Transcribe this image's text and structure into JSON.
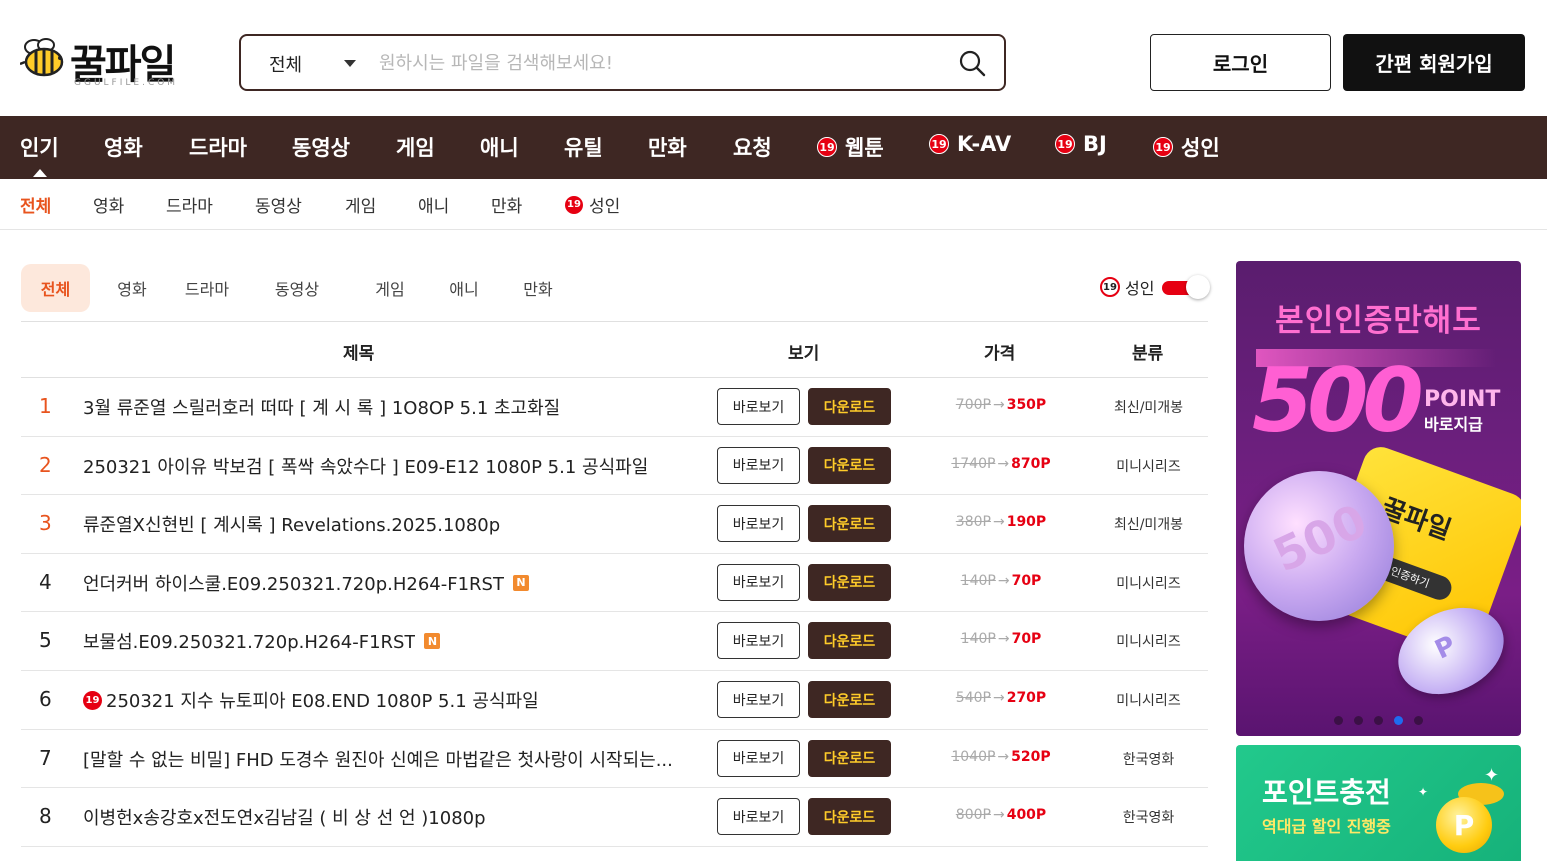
{
  "header": {
    "logo_text": "꿀파일",
    "logo_sub": "GGULFILE.COM",
    "search_category": "전체",
    "search_placeholder": "원하시는 파일을 검색해보세요!",
    "login_label": "로그인",
    "join_label": "간편 회원가입"
  },
  "main_nav": [
    {
      "label": "인기",
      "adult": false,
      "active": true
    },
    {
      "label": "영화",
      "adult": false
    },
    {
      "label": "드라마",
      "adult": false
    },
    {
      "label": "동영상",
      "adult": false
    },
    {
      "label": "게임",
      "adult": false
    },
    {
      "label": "애니",
      "adult": false
    },
    {
      "label": "유틸",
      "adult": false
    },
    {
      "label": "만화",
      "adult": false
    },
    {
      "label": "요청",
      "adult": false
    },
    {
      "label": "웹툰",
      "adult": true
    },
    {
      "label": "K-AV",
      "adult": true
    },
    {
      "label": "BJ",
      "adult": true
    },
    {
      "label": "성인",
      "adult": true
    }
  ],
  "adult_badge": "19",
  "sub_nav": [
    {
      "label": "전체",
      "active": true
    },
    {
      "label": "영화"
    },
    {
      "label": "드라마"
    },
    {
      "label": "동영상"
    },
    {
      "label": "게임"
    },
    {
      "label": "애니"
    },
    {
      "label": "만화"
    },
    {
      "label": "성인",
      "adult": true
    }
  ],
  "filter_tabs": [
    "전체",
    "영화",
    "드라마",
    "동영상",
    "게임",
    "애니",
    "만화"
  ],
  "adult_filter": {
    "label": "성인",
    "enabled": true
  },
  "table": {
    "headers": {
      "title": "제목",
      "view": "보기",
      "price": "가격",
      "category": "분류"
    },
    "view_label": "바로보기",
    "download_label": "다운로드",
    "arrow": "→",
    "rows": [
      {
        "rank": "1",
        "title": "3월 류준열 스릴러호러 떠따 [ 계 시 록 ] 1O8OP 5.1 초고화질",
        "old_price": "700P",
        "new_price": "350P",
        "category": "최신/미개봉",
        "adult": false,
        "new": false
      },
      {
        "rank": "2",
        "title": "250321 아이유 박보검 [ 폭싹 속았수다 ] E09-E12 1080P 5.1 공식파일",
        "old_price": "1740P",
        "new_price": "870P",
        "category": "미니시리즈",
        "adult": false,
        "new": false
      },
      {
        "rank": "3",
        "title": "류준열X신현빈 [ 계시록 ] Revelations.2025.1080p",
        "old_price": "380P",
        "new_price": "190P",
        "category": "최신/미개봉",
        "adult": false,
        "new": false
      },
      {
        "rank": "4",
        "title": "언더커버 하이스쿨.E09.250321.720p.H264-F1RST",
        "old_price": "140P",
        "new_price": "70P",
        "category": "미니시리즈",
        "adult": false,
        "new": true
      },
      {
        "rank": "5",
        "title": "보물섬.E09.250321.720p.H264-F1RST",
        "old_price": "140P",
        "new_price": "70P",
        "category": "미니시리즈",
        "adult": false,
        "new": true
      },
      {
        "rank": "6",
        "title": "250321 지수 뉴토피아 E08.END 1080P 5.1 공식파일",
        "old_price": "540P",
        "new_price": "270P",
        "category": "미니시리즈",
        "adult": true,
        "new": false
      },
      {
        "rank": "7",
        "title": "[말할 수 없는 비밀] FHD 도경수 원진아 신예은 마법같은 첫사랑이 시작되는...",
        "old_price": "1040P",
        "new_price": "520P",
        "category": "한국영화",
        "adult": false,
        "new": false
      },
      {
        "rank": "8",
        "title": "이병헌x송강호x전도연x김남길 ( 비 상 선 언 )1080p",
        "old_price": "800P",
        "new_price": "400P",
        "category": "한국영화",
        "adult": false,
        "new": false
      }
    ]
  },
  "new_badge": "N",
  "banner1": {
    "headline": "본인인증만해도",
    "number": "500",
    "point": "POINT",
    "sub": "바로지급",
    "card_logo": "꿀파일",
    "card_button": "본인 인증하기",
    "coin_text": "500",
    "coin_p": "P",
    "slide_count": 5,
    "active_slide": 4
  },
  "banner2": {
    "title": "포인트충전",
    "sub": "역대급 할인 진행중",
    "coin": "P"
  }
}
